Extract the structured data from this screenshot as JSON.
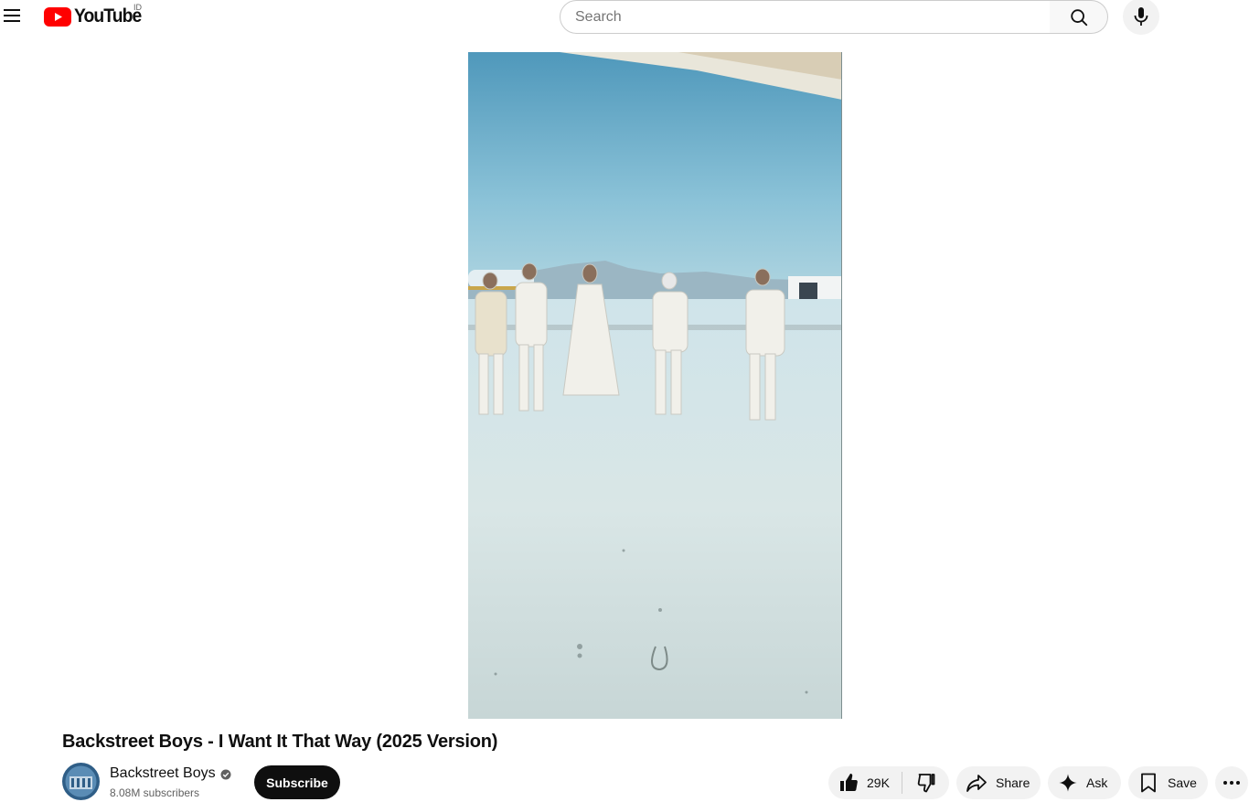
{
  "header": {
    "menu_icon": "hamburger-menu-icon",
    "logo_text": "YouTube",
    "country_code": "ID",
    "search_placeholder": "Search",
    "search_icon": "search-icon",
    "mic_icon": "microphone-icon"
  },
  "video": {
    "title": "Backstreet Boys - I Want It That Way (2025 Version)"
  },
  "channel": {
    "name": "Backstreet Boys",
    "verified_icon": "verified-check-icon",
    "subscribers": "8.08M subscribers",
    "subscribe_label": "Subscribe"
  },
  "actions": {
    "like_count": "29K",
    "like_icon": "thumbs-up-icon",
    "dislike_icon": "thumbs-down-icon",
    "share_label": "Share",
    "ask_label": "Ask",
    "save_label": "Save",
    "more_icon": "more-horizontal-icon"
  },
  "colors": {
    "brand_red": "#ff0000",
    "text_primary": "#0f0f0f",
    "text_secondary": "#606060",
    "pill_bg": "#f2f2f2",
    "subscribe_bg": "#0f0f0f"
  }
}
